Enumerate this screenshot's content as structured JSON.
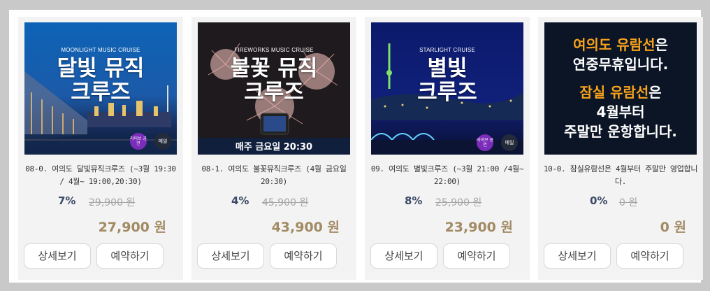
{
  "buttons": {
    "detail": "상세보기",
    "reserve": "예약하기"
  },
  "cards": [
    {
      "title": "08-0. 여의도 달빛뮤직크루즈 (~3월 19:30 / 4월~ 19:00,20:30)",
      "discount": "7%",
      "original_price": "29,900 원",
      "final_price": "27,900 원",
      "image": {
        "en": "MOONLIGHT MUSIC CRUISE",
        "ko_line1": "달빛 뮤직",
        "ko_line2": "크루즈",
        "badge_live": "라이브 공연",
        "badge_daily": "매일"
      }
    },
    {
      "title": "08-1. 여의도 불꽃뮤직크루즈 (4월 금요일 20:30)",
      "discount": "4%",
      "original_price": "45,900 원",
      "final_price": "43,900 원",
      "image": {
        "en": "FIREWORKS MUSIC CRUISE",
        "ko_line1": "불꽃 뮤직",
        "ko_line2": "크루즈",
        "footer": "매주 금요일 20:30"
      }
    },
    {
      "title": "09. 여의도 별빛크루즈 (~3월 21:00 /4월~ 22:00)",
      "discount": "8%",
      "original_price": "25,900 원",
      "final_price": "23,900 원",
      "image": {
        "en": "STARLIGHT CRUISE",
        "ko_line1": "별빛",
        "ko_line2": "크루즈",
        "badge_live": "라이브 공연",
        "badge_daily": "매일"
      }
    },
    {
      "title": "10-0. 잠실유람선은 4월부터 주말만 영업합니다.",
      "discount": "0%",
      "original_price": "0 원",
      "final_price": "0 원",
      "image": {
        "line1_hl": "여의도 유람선",
        "line1_rest": "은",
        "line2": "연중무휴입니다.",
        "line3_hl": "잠실 유람선",
        "line3_rest": "은",
        "line4": "4월부터",
        "line5": "주말만 운항합니다."
      }
    }
  ],
  "colors": {
    "discount": "#3b4a66",
    "final": "#a28b64",
    "highlight": "#f6a21c",
    "notice_bg": "#0b1526"
  }
}
